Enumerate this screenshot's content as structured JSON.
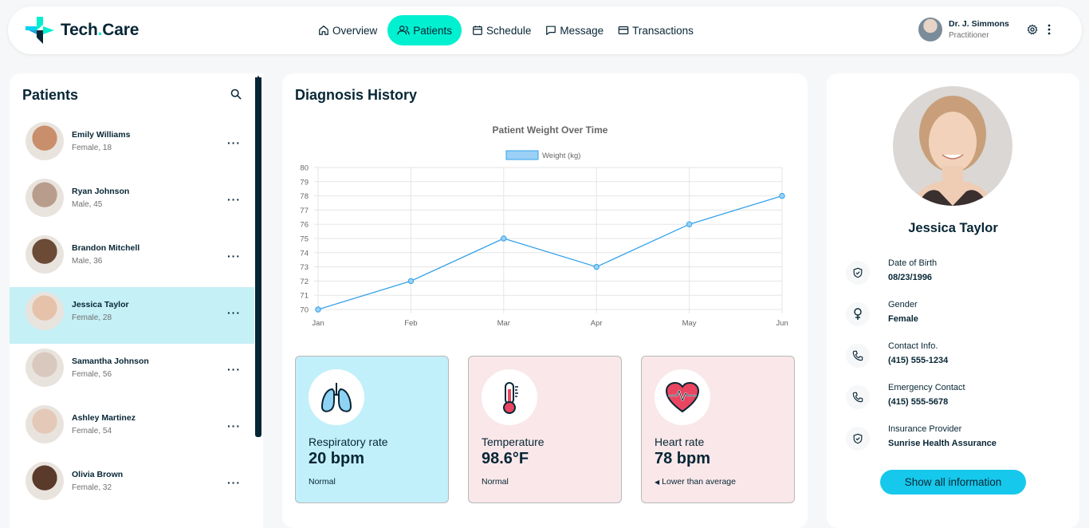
{
  "app": {
    "logo_text_main": "Tech",
    "logo_text_dot": ".",
    "logo_text_end": "Care"
  },
  "nav": [
    {
      "label": "Overview",
      "icon": "home-icon"
    },
    {
      "label": "Patients",
      "icon": "users-icon",
      "active": true
    },
    {
      "label": "Schedule",
      "icon": "calendar-icon"
    },
    {
      "label": "Message",
      "icon": "chat-icon"
    },
    {
      "label": "Transactions",
      "icon": "credit-card-icon"
    }
  ],
  "user": {
    "name": "Dr. J. Simmons",
    "role": "Practitioner"
  },
  "patients_panel": {
    "title": "Patients",
    "list": [
      {
        "name": "Emily Williams",
        "info": "Female, 18",
        "avatar_color": "#c98e6b"
      },
      {
        "name": "Ryan Johnson",
        "info": "Male, 45",
        "avatar_color": "#b89d8c"
      },
      {
        "name": "Brandon Mitchell",
        "info": "Male, 36",
        "avatar_color": "#6b4a36"
      },
      {
        "name": "Jessica Taylor",
        "info": "Female, 28",
        "avatar_color": "#e6c2aa",
        "selected": true
      },
      {
        "name": "Samantha Johnson",
        "info": "Female, 56",
        "avatar_color": "#d8c8bd"
      },
      {
        "name": "Ashley Martinez",
        "info": "Female, 54",
        "avatar_color": "#e4c9b8"
      },
      {
        "name": "Olivia Brown",
        "info": "Female, 32",
        "avatar_color": "#5a3a2a"
      }
    ]
  },
  "diagnosis": {
    "title": "Diagnosis History"
  },
  "chart_data": {
    "type": "line",
    "title": "Patient Weight Over Time",
    "categories": [
      "Jan",
      "Feb",
      "Mar",
      "Apr",
      "May",
      "Jun"
    ],
    "series": [
      {
        "name": "Weight (kg)",
        "values": [
          70,
          72,
          75,
          73,
          76,
          78
        ],
        "color": "#36a2eb"
      }
    ],
    "ylim": [
      70,
      80
    ],
    "yticks": [
      70,
      71,
      72,
      73,
      74,
      75,
      76,
      77,
      78,
      79,
      80
    ],
    "grid": true,
    "legend": "top"
  },
  "vitals": [
    {
      "label": "Respiratory rate",
      "value": "20 bpm",
      "status": "Normal",
      "icon": "lungs-icon",
      "bg": "#c2f0fa"
    },
    {
      "label": "Temperature",
      "value": "98.6°F",
      "status": "Normal",
      "icon": "thermometer-icon",
      "bg": "#f9e7e9"
    },
    {
      "label": "Heart rate",
      "value": "78 bpm",
      "status": "Lower than average",
      "icon": "heart-rate-icon",
      "bg": "#f9e7e9"
    }
  ],
  "profile": {
    "name": "Jessica Taylor",
    "fields": [
      {
        "label": "Date of Birth",
        "value": "08/23/1996",
        "icon": "shield-check-icon"
      },
      {
        "label": "Gender",
        "value": "Female",
        "icon": "female-icon"
      },
      {
        "label": "Contact Info.",
        "value": "(415) 555-1234",
        "icon": "phone-icon"
      },
      {
        "label": "Emergency Contact",
        "value": "(415) 555-5678",
        "icon": "phone-icon"
      },
      {
        "label": "Insurance Provider",
        "value": "Sunrise Health Assurance",
        "icon": "shield-check-icon"
      }
    ],
    "button_label": "Show all information"
  }
}
